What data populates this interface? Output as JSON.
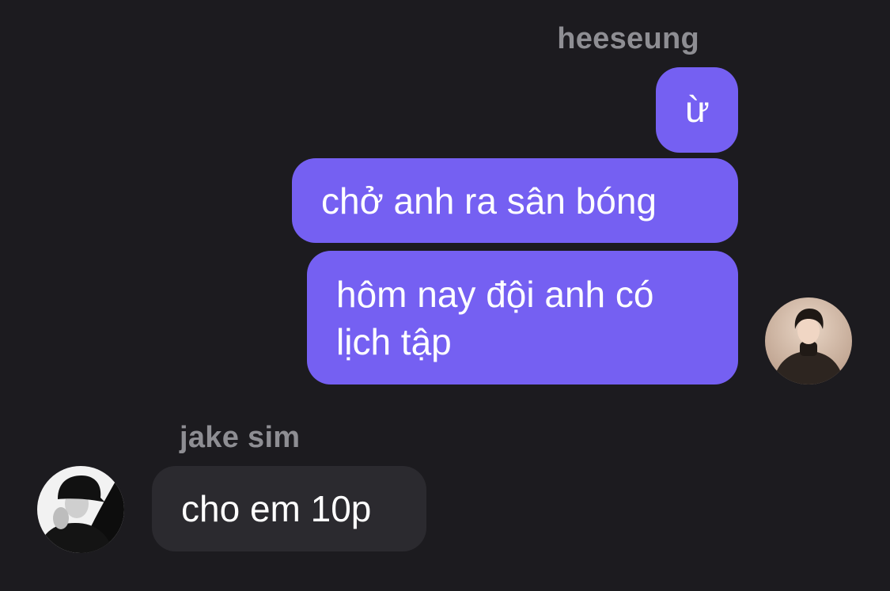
{
  "chat": {
    "outgoing": {
      "sender_name": "heeseung",
      "avatar_icon": "person-avatar-turtleneck",
      "messages": [
        {
          "text": "ừ"
        },
        {
          "text": "chở anh ra sân bóng"
        },
        {
          "text": "hôm nay đội anh có lịch tập"
        }
      ]
    },
    "incoming": {
      "sender_name": "jake sim",
      "avatar_icon": "person-avatar-cap",
      "messages": [
        {
          "text": "cho em 10p"
        }
      ]
    }
  },
  "colors": {
    "background": "#1c1b1f",
    "outgoing_bubble": "#7560f2",
    "incoming_bubble": "#2b2a2f",
    "sender_name": "#8e8e93",
    "message_text": "#ffffff"
  }
}
